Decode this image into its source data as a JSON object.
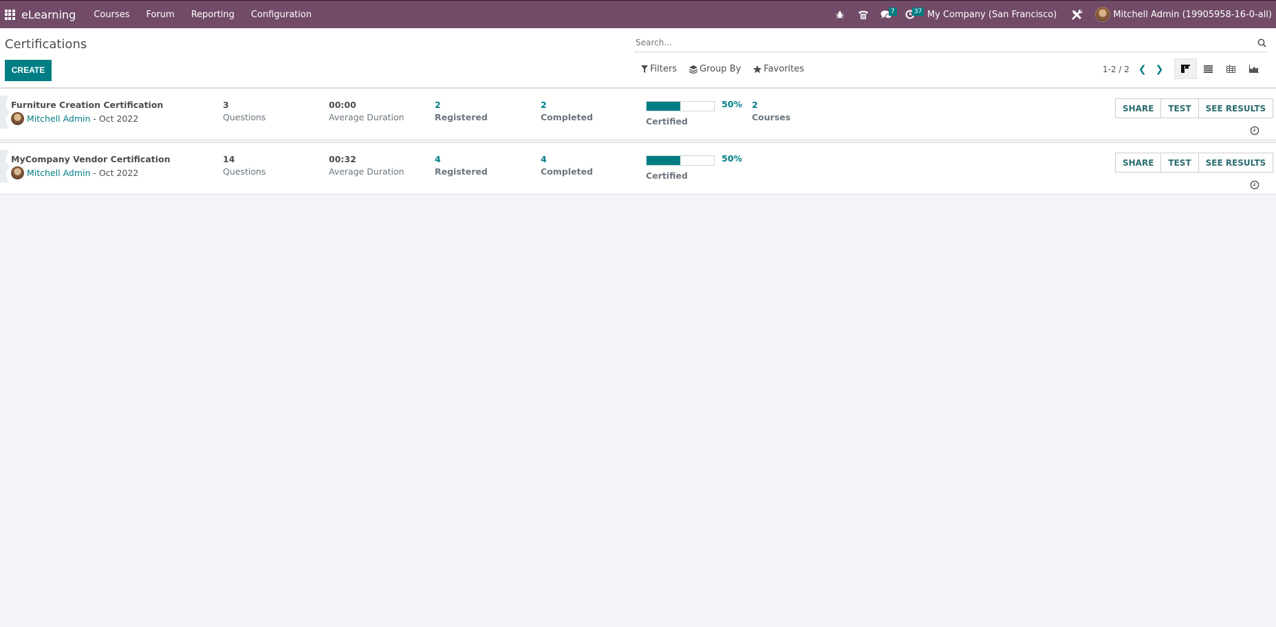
{
  "navbar": {
    "app_name": "eLearning",
    "menu": [
      "Courses",
      "Forum",
      "Reporting",
      "Configuration"
    ],
    "messages_badge": "7",
    "activities_badge": "37",
    "company": "My Company (San Francisco)",
    "user": "Mitchell Admin (19905958-16-0-all)"
  },
  "control": {
    "title": "Certifications",
    "create_label": "CREATE",
    "search_placeholder": "Search...",
    "filters_label": "Filters",
    "groupby_label": "Group By",
    "favorites_label": "Favorites",
    "pager": "1-2 / 2",
    "views": [
      "kanban",
      "list",
      "pivot",
      "graph"
    ],
    "active_view": "kanban"
  },
  "labels": {
    "questions": "Questions",
    "avg_duration": "Average Duration",
    "registered": "Registered",
    "completed": "Completed",
    "certified": "Certified",
    "courses": "Courses",
    "share": "SHARE",
    "test": "TEST",
    "see_results": "SEE RESULTS",
    "sep": " - "
  },
  "certifications": [
    {
      "name": "Furniture Creation Certification",
      "author": "Mitchell Admin",
      "date": "Oct 2022",
      "questions": "3",
      "avg_duration": "00:00",
      "registered": "2",
      "completed": "2",
      "certified_percent": 50,
      "certified_label": "50%",
      "courses": "2"
    },
    {
      "name": "MyCompany Vendor Certification",
      "author": "Mitchell Admin",
      "date": "Oct 2022",
      "questions": "14",
      "avg_duration": "00:32",
      "registered": "4",
      "completed": "4",
      "certified_percent": 50,
      "certified_label": "50%",
      "courses": null
    }
  ],
  "colors": {
    "navbar": "#714b67",
    "primary": "#017e84"
  }
}
